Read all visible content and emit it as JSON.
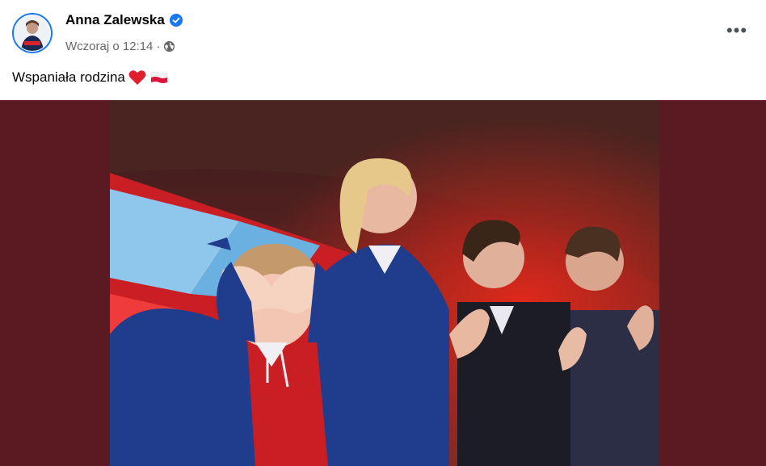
{
  "post": {
    "author": "Anna Zalewska",
    "verified": true,
    "timestamp": "Wczoraj o 12:14",
    "separator": "·",
    "privacy_icon": "globe-icon",
    "menu_icon": "more-options-icon",
    "menu_label": "•••",
    "text": "Wspaniała rodzina",
    "emojis": [
      "red-heart-emoji",
      "poland-flag-emoji"
    ]
  },
  "colors": {
    "verified_badge": "#1877f2",
    "media_background": "#5a1a22",
    "stage_red": "#d8232a",
    "outfit_blue": "#1f3d8c"
  }
}
